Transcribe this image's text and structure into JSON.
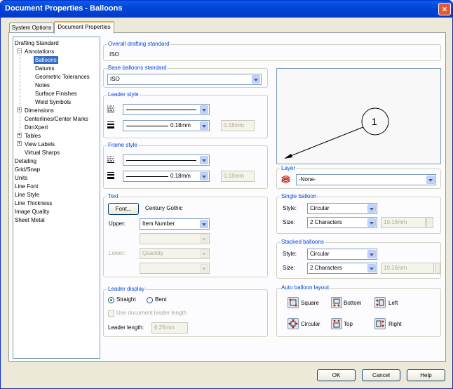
{
  "window": {
    "title": "Document Properties - Balloons",
    "close": "×"
  },
  "tabs": [
    "System Options",
    "Document Properties"
  ],
  "tree": {
    "items": [
      "Drafting Standard",
      "Annotations",
      "Balloons",
      "Datums",
      "Geometric Tolerances",
      "Notes",
      "Surface Finishes",
      "Weld Symbols",
      "Dimensions",
      "Centerlines/Center Marks",
      "DimXpert",
      "Tables",
      "View Labels",
      "Virtual Sharps",
      "Detailing",
      "Grid/Snap",
      "Units",
      "Line Font",
      "Line Style",
      "Line Thickness",
      "Image Quality",
      "Sheet Metal"
    ]
  },
  "overall": {
    "title": "Overall drafting standard",
    "value": "ISO"
  },
  "base": {
    "title": "Base balloons standard",
    "value": "ISO"
  },
  "leader_style": {
    "title": "Leader style",
    "thickness": "0.18mm",
    "custom": "0.18mm"
  },
  "frame_style": {
    "title": "Frame style",
    "thickness": "0.18mm",
    "custom": "0.18mm"
  },
  "text": {
    "title": "Text",
    "font_button": "Font...",
    "font_name": "Century Gothic",
    "upper_label": "Upper:",
    "upper_value": "Item Number",
    "lower_label": "Lower:",
    "lower_value": "Quantity"
  },
  "leader_display": {
    "title": "Leader display",
    "straight": "Straight",
    "bent": "Bent",
    "use_doc": "Use document leader length",
    "length_label": "Leader length:",
    "length_value": "6.25mm"
  },
  "preview": {
    "balloon_text": "1"
  },
  "layer": {
    "title": "Layer",
    "value": "-None-"
  },
  "single": {
    "title": "Single balloon",
    "style_label": "Style:",
    "style_value": "Circular",
    "size_label": "Size:",
    "size_value": "2 Characters",
    "custom": "10.16mm"
  },
  "stacked": {
    "title": "Stacked balloons",
    "style_label": "Style:",
    "style_value": "Circular",
    "size_label": "Size:",
    "size_value": "2 Characters",
    "custom": "10.16mm"
  },
  "auto": {
    "title": "Auto balloon layout",
    "square": "Square",
    "bottom": "Bottom",
    "left": "Left",
    "circular": "Circular",
    "top": "Top",
    "right": "Right"
  },
  "buttons": {
    "ok": "OK",
    "cancel": "Cancel",
    "help": "Help"
  }
}
